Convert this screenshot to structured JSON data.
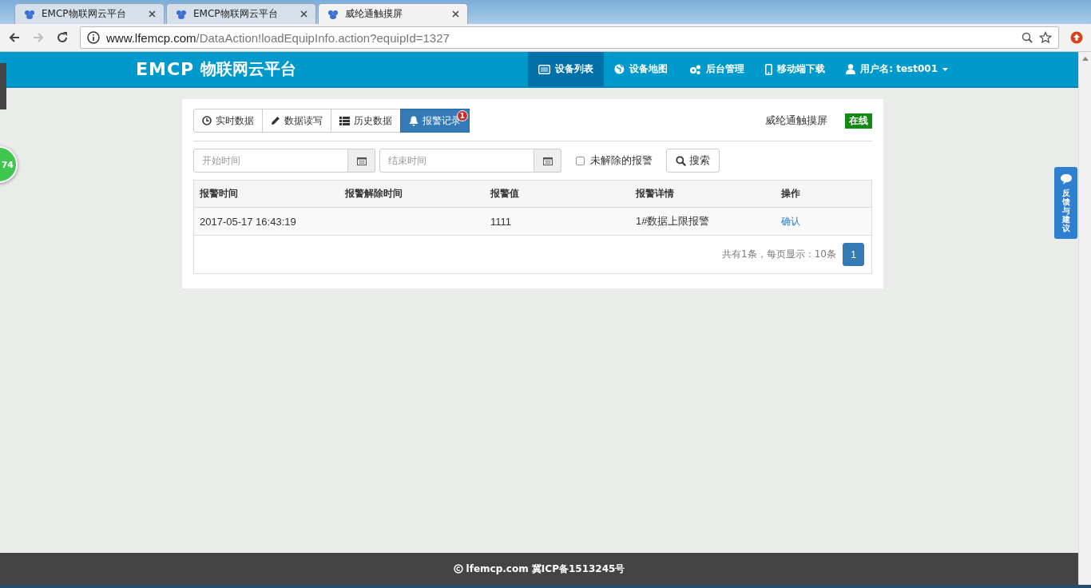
{
  "browser": {
    "tabs": [
      {
        "title": "EMCP物联网云平台",
        "selected": false
      },
      {
        "title": "EMCP物联网云平台",
        "selected": false
      },
      {
        "title": "威纶通触摸屏",
        "selected": true
      }
    ],
    "url_host": "www.lfemcp.com",
    "url_path": "/DataAction!loadEquipInfo.action?equipId=1327"
  },
  "navbar": {
    "brand_logo": "EMCP",
    "brand_title": "物联网云平台",
    "items": [
      {
        "label": "设备列表",
        "kind": "list",
        "selected": true
      },
      {
        "label": "设备地图",
        "kind": "globe",
        "selected": false
      },
      {
        "label": "后台管理",
        "kind": "gears",
        "selected": false
      },
      {
        "label": "移动端下载",
        "kind": "phone",
        "selected": false
      },
      {
        "label": "用户名: test001",
        "kind": "user",
        "selected": false
      }
    ]
  },
  "floating_badge": "74",
  "tabs": [
    {
      "label": "实时数据",
      "kind": "clock",
      "selected": false
    },
    {
      "label": "数据读写",
      "kind": "pencil",
      "selected": false
    },
    {
      "label": "历史数据",
      "kind": "list",
      "selected": false
    },
    {
      "label": "报警记录",
      "kind": "bell",
      "selected": true,
      "badge": "1"
    }
  ],
  "device_name": "威纶通触摸屏",
  "status": "在线",
  "filters": {
    "start": {
      "placeholder": "开始时间"
    },
    "end": {
      "placeholder": "结束时间"
    },
    "unresolved_only": {
      "label": "未解除的报警",
      "checked": false
    },
    "search_button": "搜索"
  },
  "table": {
    "columns": [
      "报警时间",
      "报警解除时间",
      "报警值",
      "报警详情",
      "操作"
    ],
    "rows": [
      {
        "time": "2017-05-17 16:43:19",
        "cleared": "",
        "value": "1111",
        "detail": "1#数据上限报警",
        "action": "确认"
      }
    ]
  },
  "pagination": {
    "summary": "共有1条，每页显示：10条",
    "pages": [
      {
        "label": "1",
        "selected": true
      }
    ]
  },
  "feedback": "反馈与建议",
  "footer": {
    "site": "lfemcp.com",
    "icp": "冀ICP备1513245号"
  }
}
